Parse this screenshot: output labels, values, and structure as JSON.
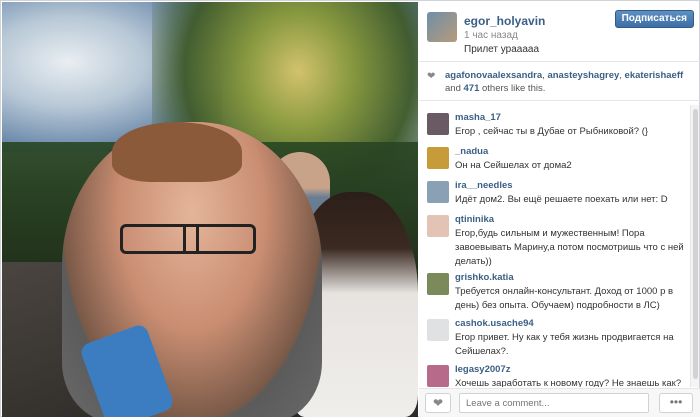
{
  "post": {
    "username": "egor_holyavin",
    "time": "1 час назад",
    "caption": "Прилет урааааа",
    "follow_label": "Подписаться"
  },
  "likes": {
    "user1": "agafonovaalexsandra",
    "user2": "anasteyshagrey",
    "user3": "ekaterishaeff",
    "and": "and",
    "count": "471",
    "suffix": "others like this."
  },
  "comments": [
    {
      "user": "masha_17",
      "text": "Егор , сейчас ты в Дубае от Рыбниковой? (}",
      "avatar_color": "#6a5a63"
    },
    {
      "user": "_nadua",
      "text": "Он на Сейшелах от дома2",
      "avatar_color": "#c79a3a"
    },
    {
      "user": "ira__needles",
      "text": "Идёт дом2. Вы ещё решаете поехать или нет: D",
      "avatar_color": "#8aa1b5"
    },
    {
      "user": "qtininika",
      "text": "Егор,будь сильным и мужественным! Пора завоевывать Марину,а потом посмотришь что с ней делать))",
      "avatar_color": "#e3c4b4"
    },
    {
      "user": "grishko.katia",
      "text": "Требуется онлайн-консультант. Доход от 1000 р в день) без опыта. Обучаем) подробности в ЛС)",
      "avatar_color": "#7a8a5a"
    },
    {
      "user": "cashok.usache94",
      "text": "Егор привет. Ну как у тебя жизнь продвигается на Сейшелах?.",
      "avatar_color": "#dfe1e3"
    },
    {
      "user": "legasy2007z",
      "text": "Хочешь заработать к новому году? Не знаешь как?",
      "avatar_color": "#b86a8a"
    }
  ],
  "footer": {
    "comment_placeholder": "Leave a comment...",
    "more_label": "•••"
  }
}
